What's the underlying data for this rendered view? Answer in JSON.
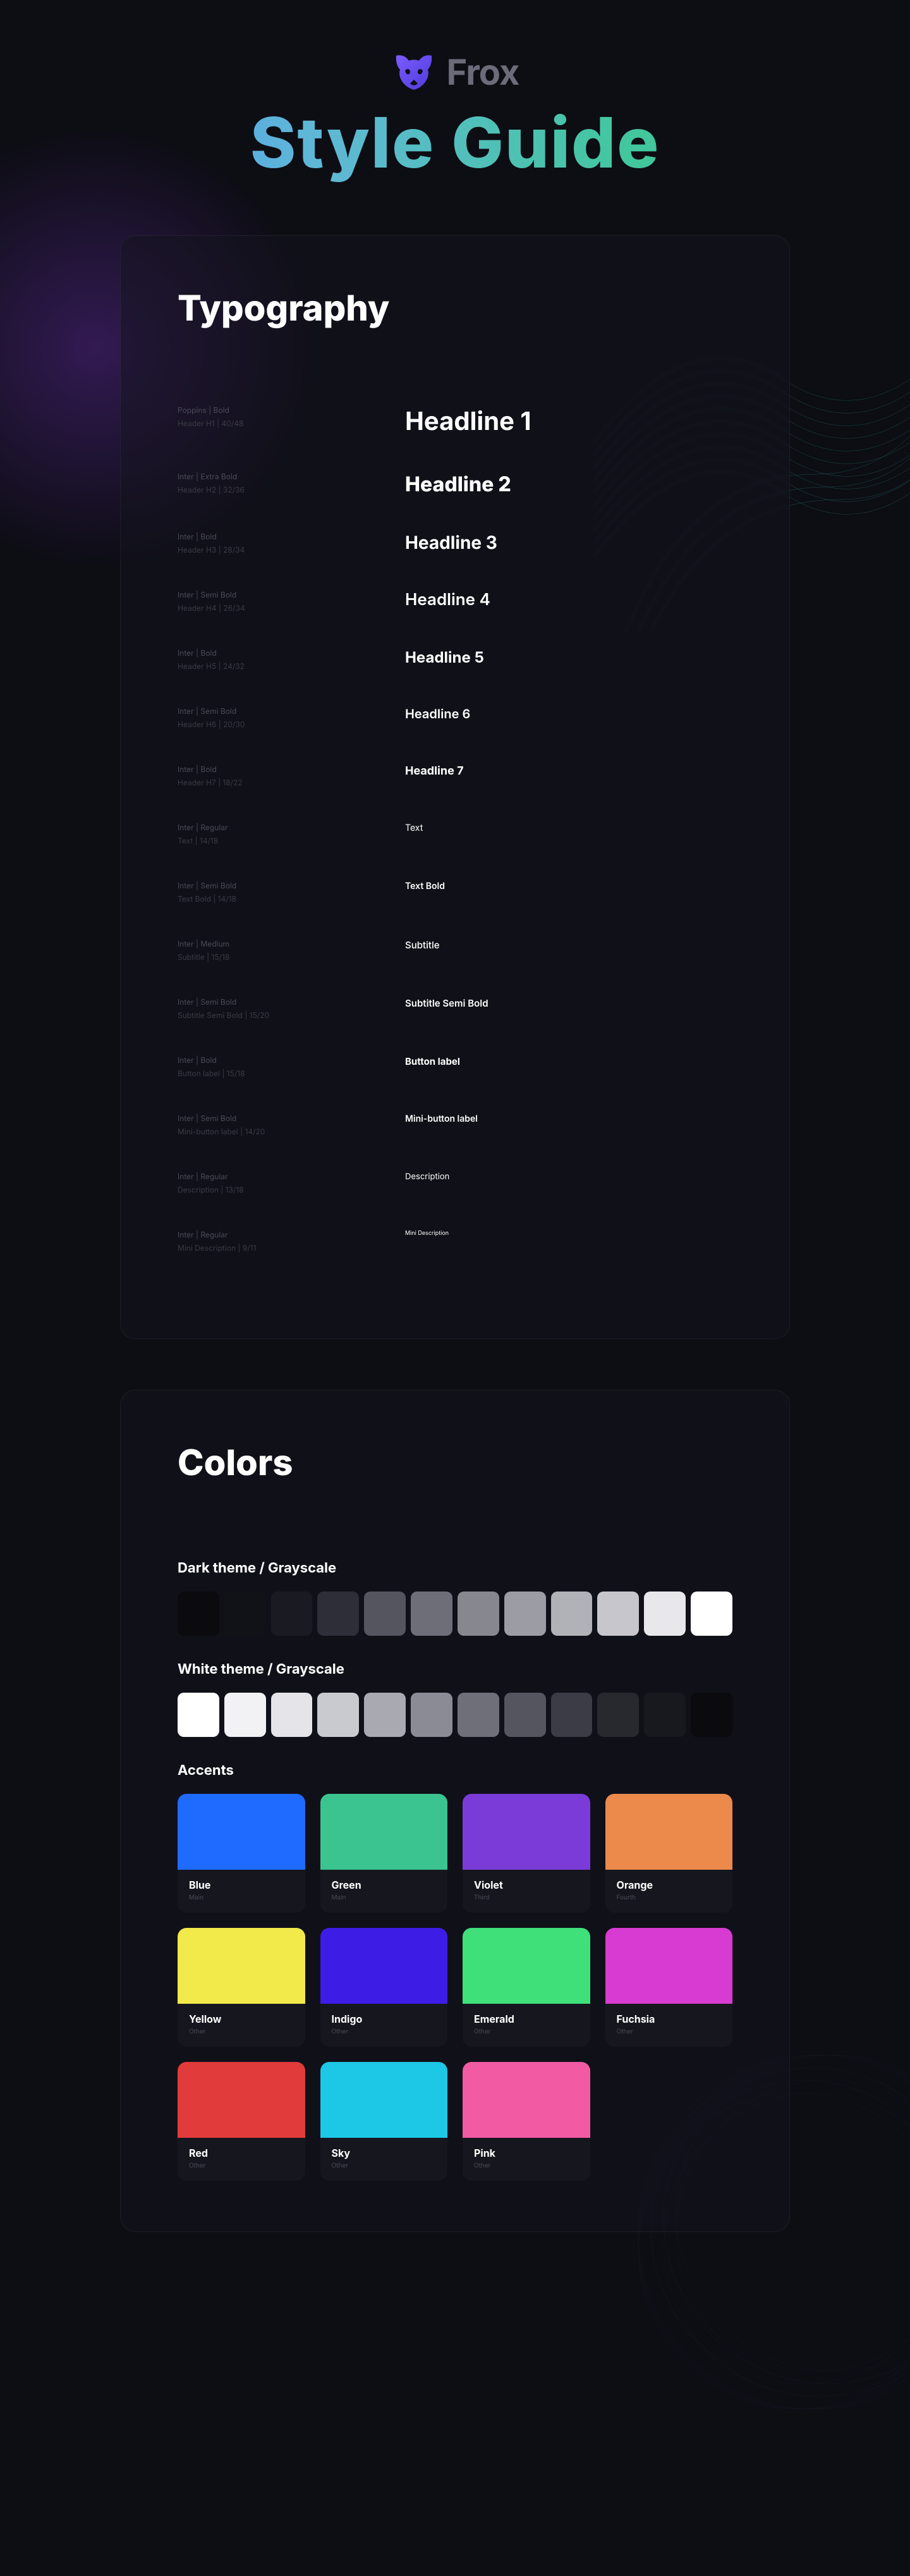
{
  "brand": {
    "name": "Frox"
  },
  "title": "Style Guide",
  "typography": {
    "heading": "Typography",
    "rows": [
      {
        "meta1": "Poppins  |  Bold",
        "meta2": "Header  H1  |  40/48",
        "sample": "Headline 1",
        "cls": "h1"
      },
      {
        "meta1": "Inter  |  Extra Bold",
        "meta2": "Header  H2  |  32/36",
        "sample": "Headline 2",
        "cls": "h2"
      },
      {
        "meta1": "Inter  |  Bold",
        "meta2": "Header  H3  |  28/34",
        "sample": "Headline 3",
        "cls": "h3"
      },
      {
        "meta1": "Inter  |  Semi Bold",
        "meta2": "Header  H4  |  26/34",
        "sample": "Headline 4",
        "cls": "h4"
      },
      {
        "meta1": "Inter  |  Bold",
        "meta2": "Header  H5  |  24/32",
        "sample": "Headline 5",
        "cls": "h5"
      },
      {
        "meta1": "Inter  |  Semi Bold",
        "meta2": "Header  H6  |  20/30",
        "sample": "Headline 6",
        "cls": "h6"
      },
      {
        "meta1": "Inter  |  Bold",
        "meta2": "Header  H7  |  18/22",
        "sample": "Headline 7",
        "cls": "h7"
      },
      {
        "meta1": "Inter  |  Regular",
        "meta2": "Text  |  14/18",
        "sample": "Text",
        "cls": "txt"
      },
      {
        "meta1": "Inter  |  Semi Bold",
        "meta2": "Text Bold  |  14/18",
        "sample": "Text Bold",
        "cls": "txtb"
      },
      {
        "meta1": "Inter  |  Medium",
        "meta2": "Subtitle  |  15/18",
        "sample": "Subtitle",
        "cls": "sub"
      },
      {
        "meta1": "Inter  |  Semi Bold",
        "meta2": "Subtitle Semi Bold  |  15/20",
        "sample": "Subtitle Semi Bold",
        "cls": "subsb"
      },
      {
        "meta1": "Inter  |  Bold",
        "meta2": "Button label  |  15/18",
        "sample": "Button label",
        "cls": "btn"
      },
      {
        "meta1": "Inter  |  Semi Bold",
        "meta2": "Mini-button label  |  14/20",
        "sample": "Mini-button label",
        "cls": "mbtn"
      },
      {
        "meta1": "Inter  |  Regular",
        "meta2": "Description  |  13/18",
        "sample": "Description",
        "cls": "desc"
      },
      {
        "meta1": "Inter  |  Regular",
        "meta2": "Mini Description  |  9/11",
        "sample": "Mini Description",
        "cls": "mdesc"
      }
    ]
  },
  "colors": {
    "heading": "Colors",
    "dark_label": "Dark theme / Grayscale",
    "dark": [
      "#0a0a0f",
      "#111118",
      "#1a1a22",
      "#2e2e38",
      "#55555f",
      "#6e6e78",
      "#87878f",
      "#9c9ca4",
      "#b1b1b8",
      "#c6c6cc",
      "#e8e8ec",
      "#ffffff"
    ],
    "white_label": "White theme / Grayscale",
    "white": [
      "#ffffff",
      "#f2f2f5",
      "#e4e4e9",
      "#c9c9d0",
      "#a9a9b2",
      "#8b8b95",
      "#6f6f7a",
      "#55555f",
      "#3c3c46",
      "#28282f",
      "#18181f",
      "#0a0a0f"
    ],
    "accents_label": "Accents",
    "accents": [
      {
        "name": "Blue",
        "sub": "Main",
        "hex": "#1f6bff"
      },
      {
        "name": "Green",
        "sub": "Main",
        "hex": "#3bc490"
      },
      {
        "name": "Violet",
        "sub": "Third",
        "hex": "#7a3bd9"
      },
      {
        "name": "Orange",
        "sub": "Fourth",
        "hex": "#ec8a4b"
      },
      {
        "name": "Yellow",
        "sub": "Other",
        "hex": "#f2e94b"
      },
      {
        "name": "Indigo",
        "sub": "Other",
        "hex": "#3d1de6"
      },
      {
        "name": "Emerald",
        "sub": "Other",
        "hex": "#3fe07a"
      },
      {
        "name": "Fuchsia",
        "sub": "Other",
        "hex": "#d83bd1"
      },
      {
        "name": "Red",
        "sub": "Other",
        "hex": "#e23b3b"
      },
      {
        "name": "Sky",
        "sub": "Other",
        "hex": "#1cc8e6"
      },
      {
        "name": "Pink",
        "sub": "Other",
        "hex": "#f25aa3"
      }
    ]
  }
}
